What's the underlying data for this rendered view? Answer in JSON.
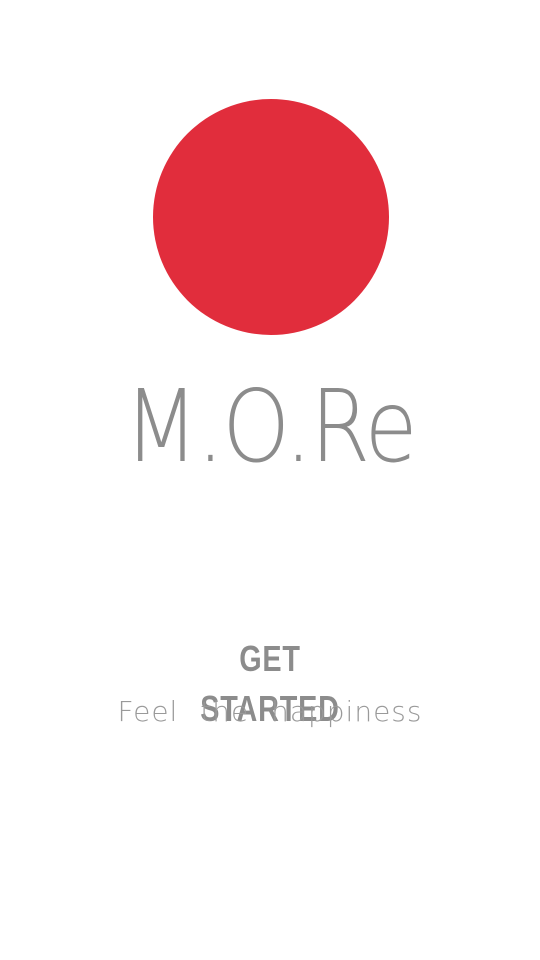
{
  "brand": {
    "name": "M.O.Re",
    "logo_color": "#e12d3c"
  },
  "cta": {
    "label": "GET STARTED"
  },
  "tagline": "Feel  the  happiness",
  "colors": {
    "text": "#8c8c8c",
    "background": "#ffffff"
  }
}
